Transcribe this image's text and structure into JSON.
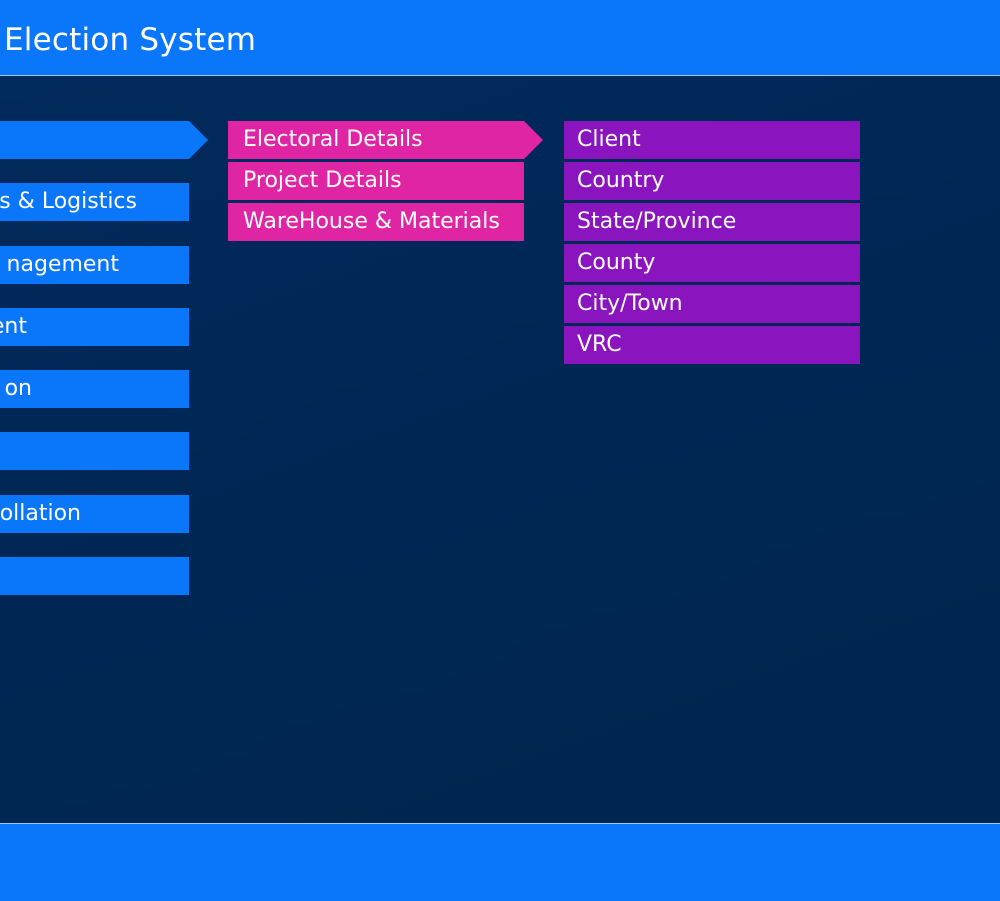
{
  "header": {
    "title": "Election System"
  },
  "main_menu": [
    {
      "label": ""
    },
    {
      "label": "s & Logistics"
    },
    {
      "label": "nagement"
    },
    {
      "label": "ent"
    },
    {
      "label": "on"
    },
    {
      "label": ""
    },
    {
      "label": "ollation"
    },
    {
      "label": ""
    }
  ],
  "sub_menu": [
    {
      "label": "Electoral Details"
    },
    {
      "label": "Project Details"
    },
    {
      "label": "WareHouse & Materials"
    }
  ],
  "leaf_menu": [
    {
      "label": "Client"
    },
    {
      "label": "Country"
    },
    {
      "label": "State/Province"
    },
    {
      "label": "County"
    },
    {
      "label": "City/Town"
    },
    {
      "label": "VRC"
    }
  ],
  "colors": {
    "header_bg": "#0a77fb",
    "content_bg": "#01295a",
    "main_item_bg": "#0a77fb",
    "sub_item_bg": "#e025a4",
    "leaf_item_bg": "#8a14bd"
  }
}
